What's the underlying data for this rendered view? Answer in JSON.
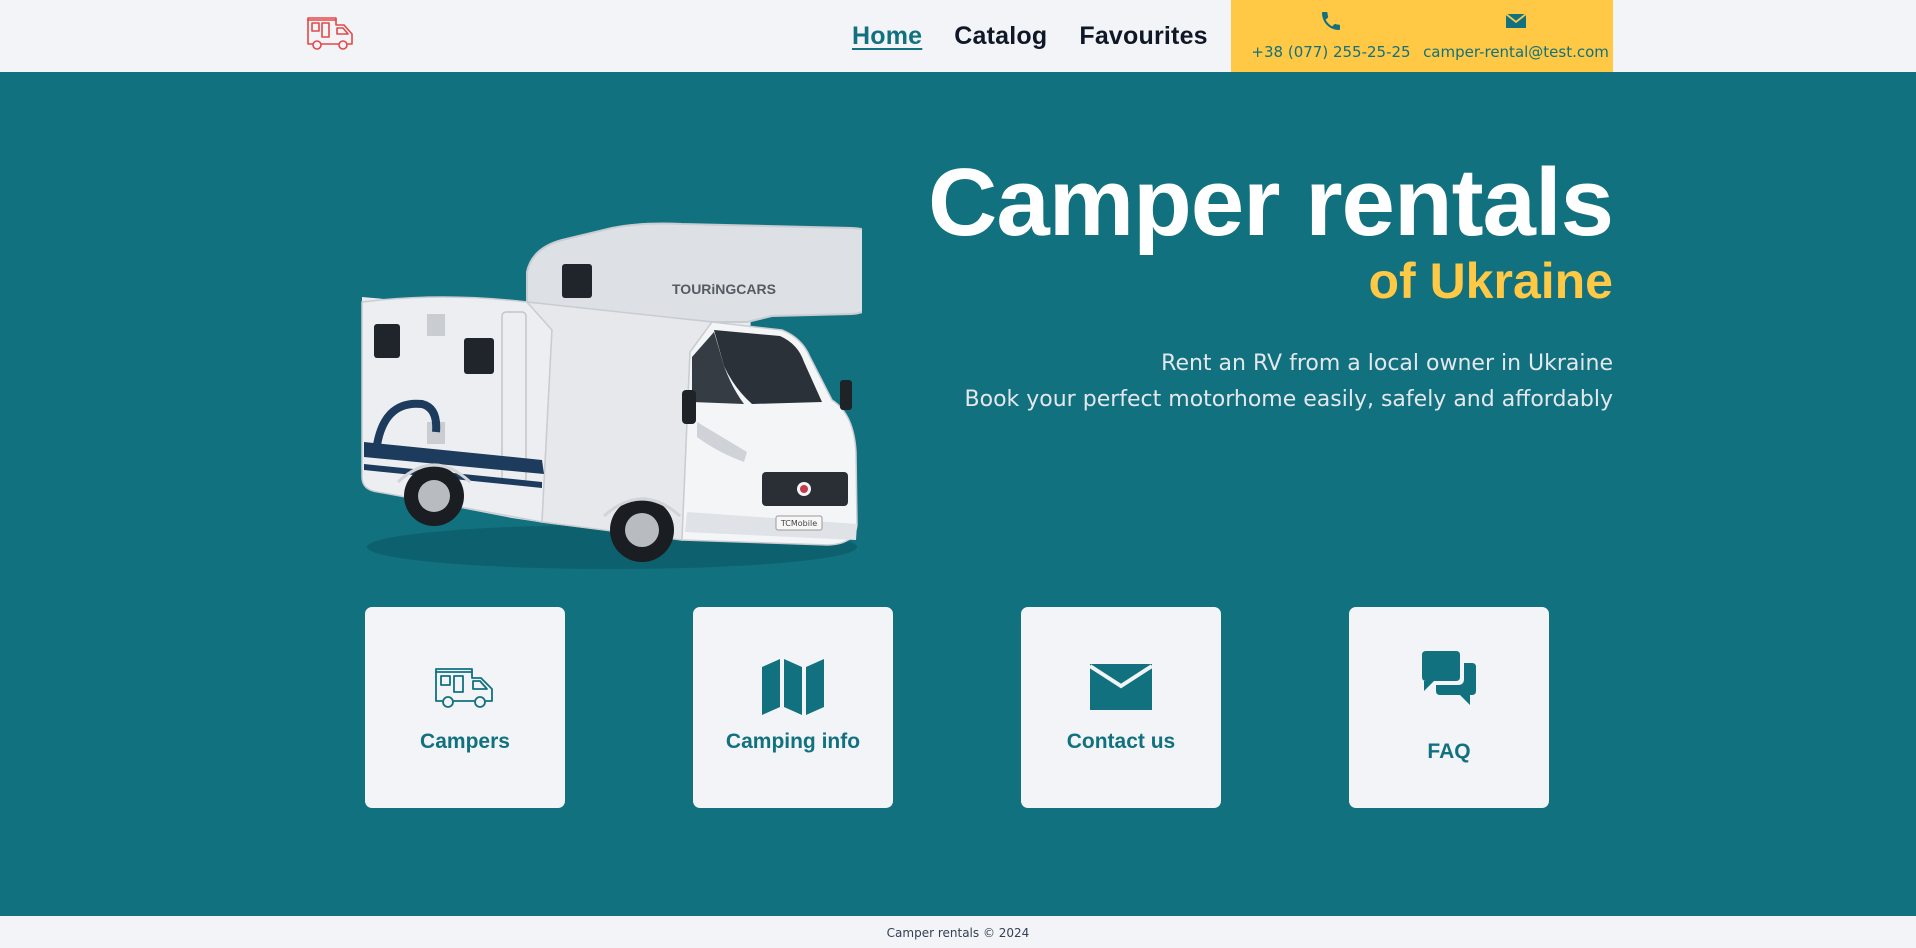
{
  "header": {
    "logo_icon": "camper-van-icon",
    "nav": [
      {
        "label": "Home",
        "active": true
      },
      {
        "label": "Catalog",
        "active": false
      },
      {
        "label": "Favourites",
        "active": false
      }
    ],
    "contact": {
      "phone": "+38 (077) 255-25-25",
      "phone_icon": "phone-icon",
      "email": "camper-rental@test.com",
      "email_icon": "envelope-icon"
    }
  },
  "hero": {
    "title": "Camper rentals",
    "subtitle": "of Ukraine",
    "description_line1": "Rent an RV from a local owner in Ukraine",
    "description_line2": "Book your perfect motorhome easily, safely and affordably",
    "image_brand": "TOURiNGCARS",
    "image_plate": "TCMobile"
  },
  "cards": [
    {
      "label": "Campers",
      "icon": "camper-van-icon"
    },
    {
      "label": "Camping info",
      "icon": "map-icon"
    },
    {
      "label": "Contact us",
      "icon": "envelope-icon"
    },
    {
      "label": "FAQ",
      "icon": "chat-bubbles-icon"
    }
  ],
  "footer": {
    "text": "Camper rentals © 2024"
  },
  "colors": {
    "accent": "#11717f",
    "brand_yellow": "#ffc845",
    "background": "#f2f4f7",
    "logo_red": "#e44848"
  }
}
